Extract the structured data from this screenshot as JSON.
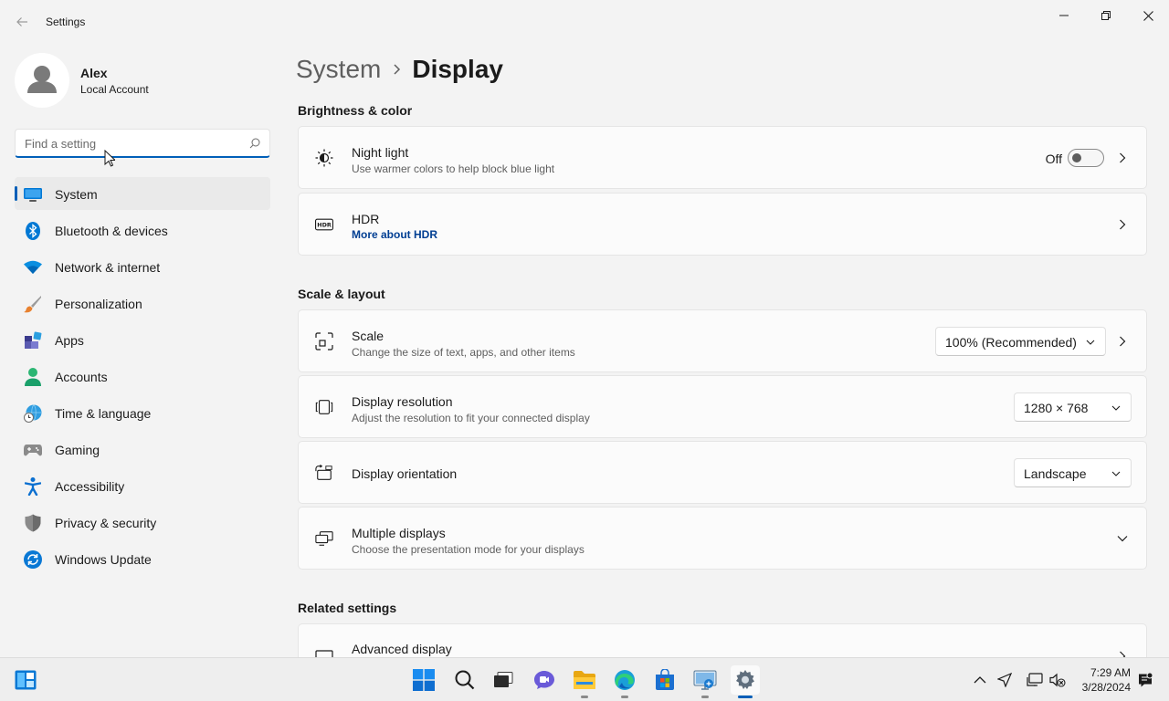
{
  "window": {
    "title": "Settings",
    "back_icon": "back-arrow-icon",
    "controls": [
      "minimize-icon",
      "restore-icon",
      "close-icon"
    ]
  },
  "profile": {
    "name": "Alex",
    "account_type": "Local Account"
  },
  "search": {
    "placeholder": "Find a setting"
  },
  "sidebar": {
    "items": [
      {
        "label": "System",
        "icon": "system-icon",
        "active": true
      },
      {
        "label": "Bluetooth & devices",
        "icon": "bluetooth-icon"
      },
      {
        "label": "Network & internet",
        "icon": "wifi-icon"
      },
      {
        "label": "Personalization",
        "icon": "brush-icon"
      },
      {
        "label": "Apps",
        "icon": "apps-icon"
      },
      {
        "label": "Accounts",
        "icon": "accounts-icon"
      },
      {
        "label": "Time & language",
        "icon": "globe-clock-icon"
      },
      {
        "label": "Gaming",
        "icon": "gamepad-icon"
      },
      {
        "label": "Accessibility",
        "icon": "accessibility-icon"
      },
      {
        "label": "Privacy & security",
        "icon": "shield-icon"
      },
      {
        "label": "Windows Update",
        "icon": "update-icon"
      }
    ]
  },
  "breadcrumb": {
    "parent": "System",
    "current": "Display"
  },
  "sections": {
    "brightness": {
      "title": "Brightness & color",
      "night_light": {
        "title": "Night light",
        "subtitle": "Use warmer colors to help block blue light",
        "state": "Off"
      },
      "hdr": {
        "title": "HDR",
        "link": "More about HDR"
      }
    },
    "scale_layout": {
      "title": "Scale & layout",
      "scale": {
        "title": "Scale",
        "subtitle": "Change the size of text, apps, and other items",
        "value": "100% (Recommended)"
      },
      "resolution": {
        "title": "Display resolution",
        "subtitle": "Adjust the resolution to fit your connected display",
        "value": "1280 × 768"
      },
      "orientation": {
        "title": "Display orientation",
        "value": "Landscape"
      },
      "multiple": {
        "title": "Multiple displays",
        "subtitle": "Choose the presentation mode for your displays"
      }
    },
    "related": {
      "title": "Related settings",
      "advanced": {
        "title": "Advanced display"
      }
    }
  },
  "taskbar": {
    "apps": [
      "start-icon",
      "search-icon",
      "task-view-icon",
      "chat-icon",
      "file-explorer-icon",
      "edge-icon",
      "store-icon",
      "remote-desktop-icon",
      "settings-icon"
    ],
    "tray": [
      "chevron-up-icon",
      "location-icon",
      "network-icon",
      "volume-muted-icon",
      "notification-icon"
    ],
    "time": "7:29 AM",
    "date": "3/28/2024"
  },
  "colors": {
    "accent": "#005fb8",
    "background": "#f3f3f3",
    "card": "#fbfbfb"
  }
}
